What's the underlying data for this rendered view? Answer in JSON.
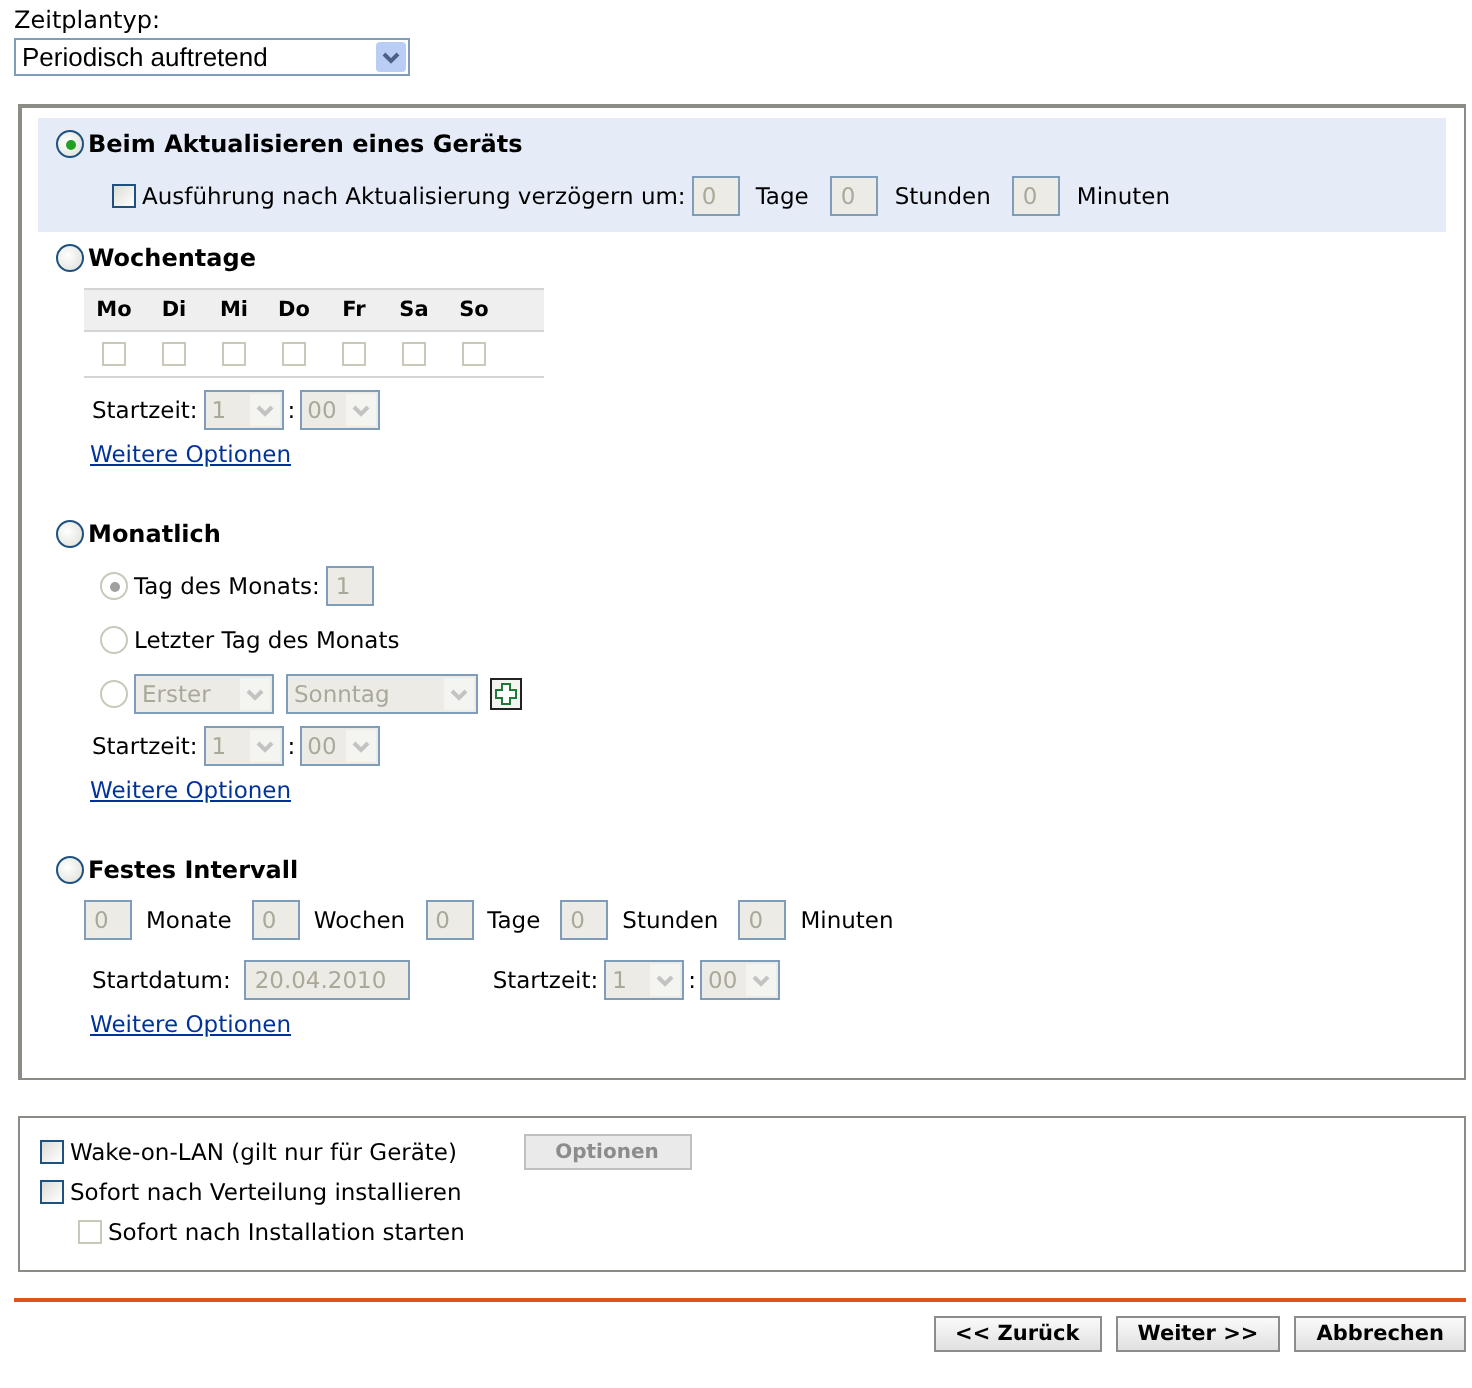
{
  "schedule_type": {
    "label": "Zeitplantyp:",
    "value": "Periodisch auftretend"
  },
  "on_device_refresh": {
    "label": "Beim Aktualisieren eines Geräts",
    "selected": true,
    "delay": {
      "label": "Ausführung nach Aktualisierung verzögern um:",
      "checked": false,
      "fields": [
        {
          "value": "0",
          "unit": "Tage"
        },
        {
          "value": "0",
          "unit": "Stunden"
        },
        {
          "value": "0",
          "unit": "Minuten"
        }
      ]
    }
  },
  "weekdays": {
    "label": "Wochentage",
    "selected": false,
    "days": [
      {
        "label": "Mo",
        "checked": false
      },
      {
        "label": "Di",
        "checked": false
      },
      {
        "label": "Mi",
        "checked": false
      },
      {
        "label": "Do",
        "checked": false
      },
      {
        "label": "Fr",
        "checked": false
      },
      {
        "label": "Sa",
        "checked": false
      },
      {
        "label": "So",
        "checked": false
      }
    ],
    "start_time": {
      "label": "Startzeit:",
      "hour": "1",
      "separator": ":",
      "minute": "00"
    },
    "more_link": "Weitere Optionen"
  },
  "monthly": {
    "label": "Monatlich",
    "selected": false,
    "choices": [
      {
        "kind": "day",
        "label": "Tag des Monats:",
        "value": "1",
        "selected": true
      },
      {
        "kind": "last",
        "label": "Letzter Tag des Monats",
        "selected": false
      },
      {
        "kind": "weekday",
        "ordinal": "Erster",
        "weekday": "Sonntag",
        "selected": false
      }
    ],
    "start_time": {
      "label": "Startzeit:",
      "hour": "1",
      "separator": ":",
      "minute": "00"
    },
    "more_link": "Weitere Optionen"
  },
  "fixed_interval": {
    "label": "Festes Intervall",
    "selected": false,
    "fields": [
      {
        "value": "0",
        "unit": "Monate"
      },
      {
        "value": "0",
        "unit": "Wochen"
      },
      {
        "value": "0",
        "unit": "Tage"
      },
      {
        "value": "0",
        "unit": "Stunden"
      },
      {
        "value": "0",
        "unit": "Minuten"
      }
    ],
    "start_date": {
      "label": "Startdatum:",
      "value": "20.04.2010"
    },
    "start_time": {
      "label": "Startzeit:",
      "hour": "1",
      "separator": ":",
      "minute": "00"
    },
    "more_link": "Weitere Optionen"
  },
  "extras": [
    {
      "label": "Wake-on-LAN (gilt nur für Geräte)",
      "checked": false,
      "disabled": false,
      "button": "Optionen"
    },
    {
      "label": "Sofort nach Verteilung installieren",
      "checked": false,
      "disabled": false,
      "children": [
        {
          "label": "Sofort nach Installation starten",
          "checked": false,
          "disabled": true
        }
      ]
    }
  ],
  "buttons": [
    "<< Zurück",
    "Weiter >>",
    "Abbrechen"
  ]
}
